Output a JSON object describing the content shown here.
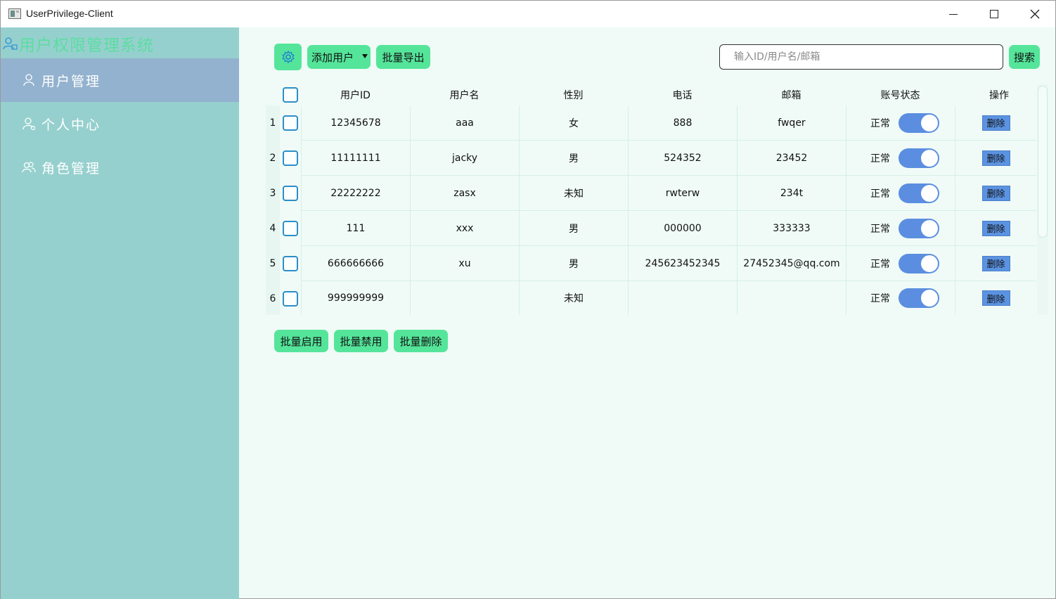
{
  "window": {
    "title": "UserPrivilege-Client"
  },
  "sidebar": {
    "brand": "用户权限管理系统",
    "items": [
      {
        "label": "用户管理",
        "icon": "user-icon",
        "active": true
      },
      {
        "label": "个人中心",
        "icon": "user-circle-icon",
        "active": false
      },
      {
        "label": "角色管理",
        "icon": "users-icon",
        "active": false
      }
    ]
  },
  "toolbar": {
    "settings_icon": "gear-icon",
    "add_user": "添加用户",
    "export": "批量导出",
    "search_placeholder": "输入ID/用户名/邮箱",
    "search": "搜索"
  },
  "table": {
    "headers": [
      "用户ID",
      "用户名",
      "性别",
      "电话",
      "邮箱",
      "账号状态",
      "操作"
    ],
    "rows": [
      {
        "no": "1",
        "id": "12345678",
        "name": "aaa",
        "gender": "女",
        "phone": "888",
        "email": "fwqer",
        "status": "正常",
        "enabled": true,
        "action": "删除"
      },
      {
        "no": "2",
        "id": "11111111",
        "name": "jacky",
        "gender": "男",
        "phone": "524352",
        "email": "23452",
        "status": "正常",
        "enabled": true,
        "action": "删除"
      },
      {
        "no": "3",
        "id": "22222222",
        "name": "zasx",
        "gender": "未知",
        "phone": "rwterw",
        "email": "234t",
        "status": "正常",
        "enabled": true,
        "action": "删除"
      },
      {
        "no": "4",
        "id": "111",
        "name": "xxx",
        "gender": "男",
        "phone": "000000",
        "email": "333333",
        "status": "正常",
        "enabled": true,
        "action": "删除"
      },
      {
        "no": "5",
        "id": "666666666",
        "name": "xu",
        "gender": "男",
        "phone": "245623452345",
        "email": "27452345@qq.com",
        "status": "正常",
        "enabled": true,
        "action": "删除"
      },
      {
        "no": "6",
        "id": "999999999",
        "name": "",
        "gender": "未知",
        "phone": "",
        "email": "",
        "status": "正常",
        "enabled": true,
        "action": "删除"
      }
    ]
  },
  "batch": {
    "enable": "批量启用",
    "disable": "批量禁用",
    "delete": "批量删除"
  },
  "colors": {
    "accent": "#55e59a",
    "sidebar": "#96d0ce",
    "active_nav": "#93b2cf",
    "toggle": "#5b8ee0",
    "checkbox": "#2b8ec9",
    "content_bg": "#f0fbf7"
  }
}
